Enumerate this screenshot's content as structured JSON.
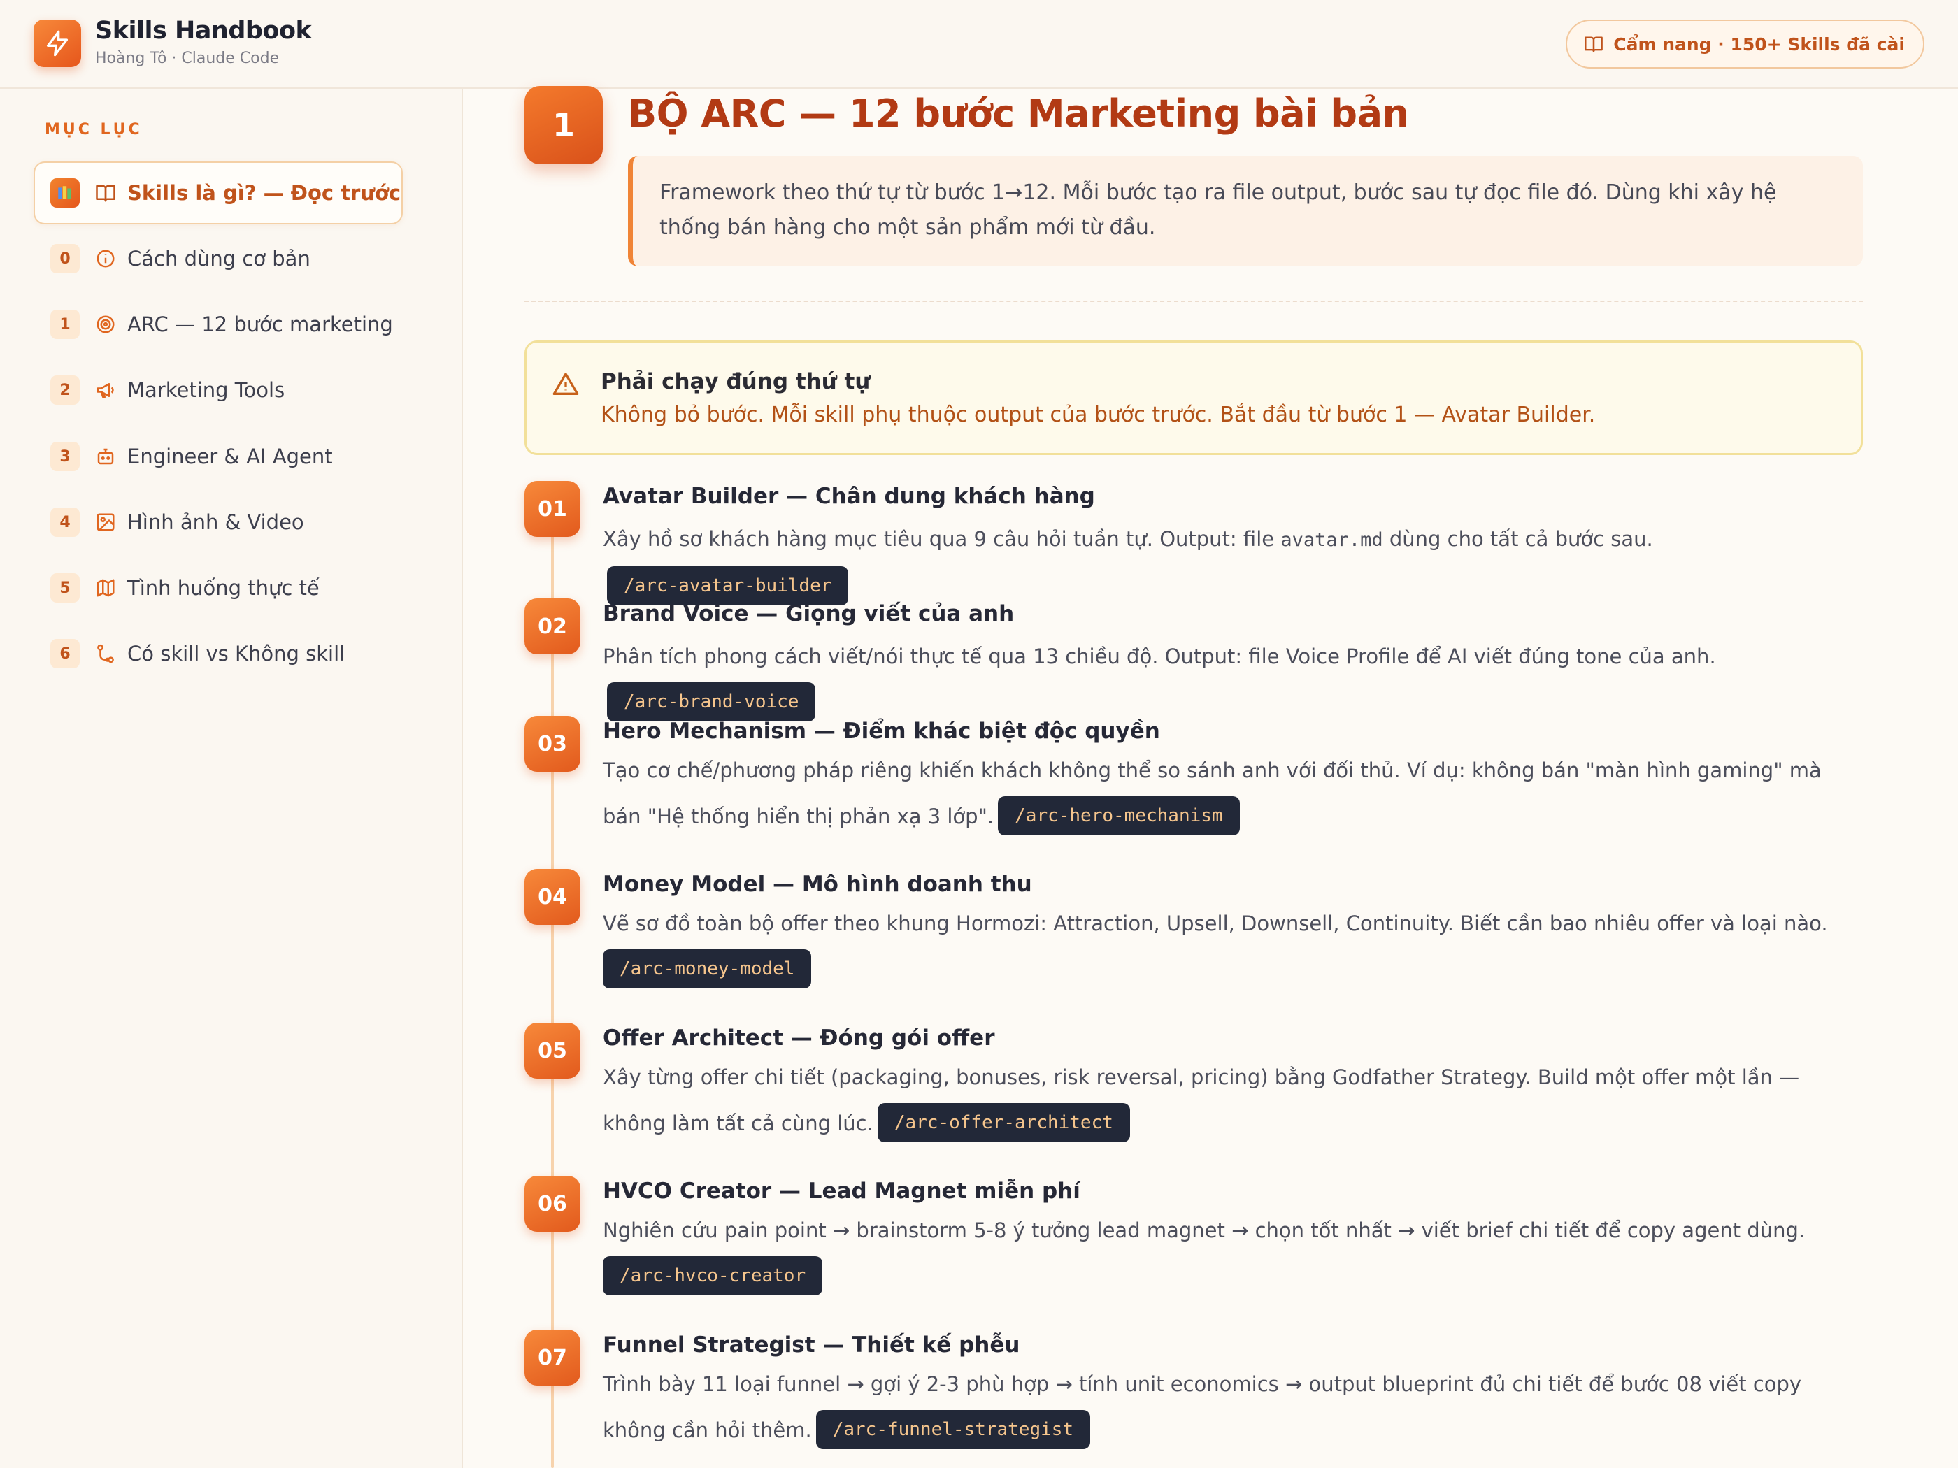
{
  "header": {
    "title": "Skills Handbook",
    "subtitle": "Hoàng Tô · Claude Code",
    "badge": "Cẩm nang · 150+ Skills đã cài"
  },
  "sidebar": {
    "heading": "MỤC LỤC",
    "items": [
      {
        "num": "",
        "icon": "book-icon",
        "label": "Skills là gì? — Đọc trước",
        "active": true
      },
      {
        "num": "0",
        "icon": "info-icon",
        "label": "Cách dùng cơ bản"
      },
      {
        "num": "1",
        "icon": "target-icon",
        "label": "ARC — 12 bước marketing"
      },
      {
        "num": "2",
        "icon": "megaphone-icon",
        "label": "Marketing Tools"
      },
      {
        "num": "3",
        "icon": "robot-icon",
        "label": "Engineer & AI Agent"
      },
      {
        "num": "4",
        "icon": "image-icon",
        "label": "Hình ảnh & Video"
      },
      {
        "num": "5",
        "icon": "map-icon",
        "label": "Tình huống thực tế"
      },
      {
        "num": "6",
        "icon": "compare-icon",
        "label": "Có skill vs Không skill"
      }
    ]
  },
  "section": {
    "number": "1",
    "title": "BỘ ARC — 12 bước Marketing bài bản",
    "intro": "Framework theo thứ tự từ bước 1→12. Mỗi bước tạo ra file output, bước sau tự đọc file đó. Dùng khi xây hệ thống bán hàng cho một sản phẩm mới từ đầu."
  },
  "warning": {
    "title": "Phải chạy đúng thứ tự",
    "text": "Không bỏ bước. Mỗi skill phụ thuộc output của bước trước. Bắt đầu từ bước 1 — Avatar Builder."
  },
  "steps": [
    {
      "num": "01",
      "title": "Avatar Builder — Chân dung khách hàng",
      "desc_a": "Xây hồ sơ khách hàng mục tiêu qua 9 câu hỏi tuần tự. Output: file ",
      "code_inline": "avatar.md",
      "desc_b": " dùng cho tất cả bước sau.",
      "cmd": "/arc-avatar-builder"
    },
    {
      "num": "02",
      "title": "Brand Voice — Giọng viết của anh",
      "desc": "Phân tích phong cách viết/nói thực tế qua 13 chiều độ. Output: file Voice Profile để AI viết đúng tone của anh.",
      "cmd": "/arc-brand-voice"
    },
    {
      "num": "03",
      "title": "Hero Mechanism — Điểm khác biệt độc quyền",
      "desc": "Tạo cơ chế/phương pháp riêng khiến khách không thể so sánh anh với đối thủ. Ví dụ: không bán \"màn hình gaming\" mà bán \"Hệ thống hiển thị phản xạ 3 lớp\".",
      "cmd": "/arc-hero-mechanism"
    },
    {
      "num": "04",
      "title": "Money Model — Mô hình doanh thu",
      "desc": "Vẽ sơ đồ toàn bộ offer theo khung Hormozi: Attraction, Upsell, Downsell, Continuity. Biết cần bao nhiêu offer và loại nào.",
      "cmd": "/arc-money-model"
    },
    {
      "num": "05",
      "title": "Offer Architect — Đóng gói offer",
      "desc": "Xây từng offer chi tiết (packaging, bonuses, risk reversal, pricing) bằng Godfather Strategy. Build một offer một lần — không làm tất cả cùng lúc.",
      "cmd": "/arc-offer-architect"
    },
    {
      "num": "06",
      "title": "HVCO Creator — Lead Magnet miễn phí",
      "desc": "Nghiên cứu pain point → brainstorm 5-8 ý tưởng lead magnet → chọn tốt nhất → viết brief chi tiết để copy agent dùng.",
      "cmd": "/arc-hvco-creator"
    },
    {
      "num": "07",
      "title": "Funnel Strategist — Thiết kế phễu",
      "desc": "Trình bày 11 loại funnel → gợi ý 2-3 phù hợp → tính unit economics → output blueprint đủ chi tiết để bước 08 viết copy không cần hỏi thêm.",
      "cmd": "/arc-funnel-strategist"
    }
  ],
  "colors": {
    "accent": "#e5591c",
    "title": "#b23a14",
    "code_bg": "#222838",
    "code_fg": "#f5c58d"
  }
}
